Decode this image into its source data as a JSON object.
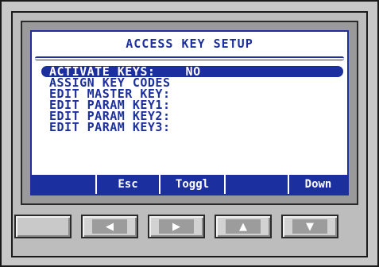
{
  "screen": {
    "title": "ACCESS KEY SETUP",
    "menu": [
      {
        "label": "ACTIVATE KEYS:    NO",
        "selected": true
      },
      {
        "label": "ASSIGN KEY CODES",
        "selected": false
      },
      {
        "label": "EDIT MASTER KEY:",
        "selected": false
      },
      {
        "label": "EDIT PARAM KEY1:",
        "selected": false
      },
      {
        "label": "EDIT PARAM KEY2:",
        "selected": false
      },
      {
        "label": "EDIT PARAM KEY3:",
        "selected": false
      }
    ],
    "softkeys": {
      "f1": "",
      "f2": "Esc",
      "f3": "Toggl",
      "f4": "",
      "f5": "Down"
    }
  },
  "hardware_buttons": [
    {
      "icon": "blank-key"
    },
    {
      "icon": "arrow-left-icon",
      "glyph": "◀"
    },
    {
      "icon": "arrow-right-icon",
      "glyph": "▶"
    },
    {
      "icon": "arrow-up-icon",
      "glyph": "▲"
    },
    {
      "icon": "arrow-down-icon",
      "glyph": "▼"
    }
  ],
  "colors": {
    "accent": "#1c2f9e",
    "screen_bg": "#ffffff",
    "bezel": "#c8c8c8"
  }
}
